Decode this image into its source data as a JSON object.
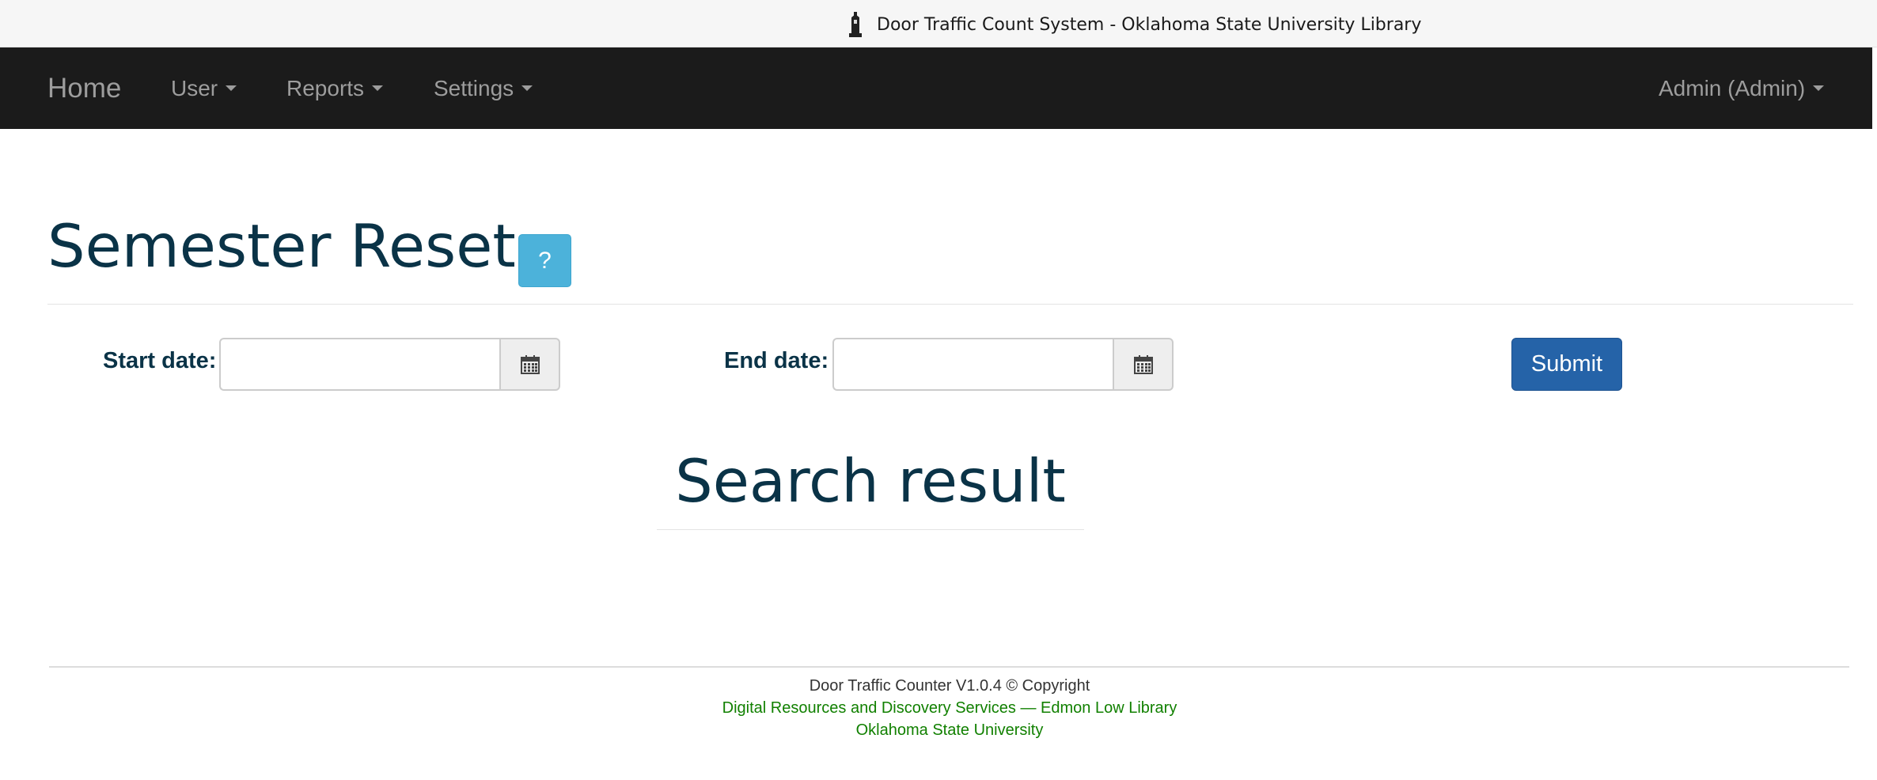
{
  "window": {
    "title": "Door Traffic Count System - Oklahoma State University Library"
  },
  "navbar": {
    "brand": "Home",
    "items": [
      {
        "label": "User"
      },
      {
        "label": "Reports"
      },
      {
        "label": "Settings"
      }
    ],
    "account": "Admin (Admin)"
  },
  "page": {
    "title": "Semester Reset",
    "help_label": "?"
  },
  "form": {
    "start_label": "Start date:",
    "start_value": "",
    "end_label": "End date:",
    "end_value": "",
    "submit_label": "Submit"
  },
  "result": {
    "title": "Search result"
  },
  "footer": {
    "version": "Door Traffic Counter V1.0.4 © Copyright",
    "department": "Digital Resources and Discovery Services — Edmon Low Library",
    "university": "Oklahoma State University"
  },
  "colors": {
    "navbar_bg": "#1b1b1b",
    "heading": "#0a3347",
    "help_button": "#4cb2da",
    "submit_button": "#2563a8",
    "footer_link": "#118000"
  },
  "icons": [
    "library-tower-icon",
    "caret-down-icon",
    "calendar-icon"
  ]
}
